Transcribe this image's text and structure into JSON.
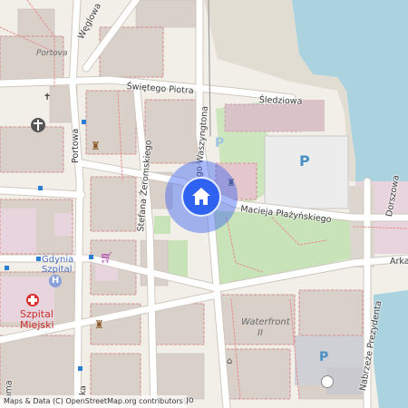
{
  "map": {
    "labels": {
      "portova_area": "Portova",
      "weglowa": "Węglowa",
      "swietego_piotra": "Świętego Piotra",
      "sledziowa": "Śledziowa",
      "jerzego_waszyngtona": "Jerzego Waszyngtona",
      "stefana_zeromskiego": "Stefana Żeromskiego",
      "portowa": "Portowa",
      "macieja_plazynskiego": "Macieja Płażyńskiego",
      "dorszowa": "Dorszowa",
      "arka": "Arka",
      "gdynia_szpital_1": "Gdynia",
      "gdynia_szpital_2": "Szpital",
      "szpital_miejski_1": "Szpital",
      "szpital_miejski_2": "Miejski",
      "waterfront_1": "Waterfront",
      "waterfront_2": "II",
      "nabrzeze": "Nabrzeże Prezydenta",
      "ama": "ama",
      "ka": "ka",
      "go": "go"
    },
    "parking_symbol": "P",
    "hospital_symbol": "H",
    "attribution": "Maps & Data (C) OpenStreetMap.org contributors",
    "colors": {
      "water": "#aad3df",
      "park": "#c8e3b8",
      "building": "#d9d0c9",
      "road": "#ffffff",
      "pin": "#2f62f0",
      "parking": "#4a90c2",
      "hospital": "#d9302e"
    },
    "icons": [
      "church-icon",
      "museum-icon",
      "shop-icon",
      "hospital-icon",
      "theatre-icon",
      "fountain-icon",
      "home-icon",
      "parking-icon"
    ]
  }
}
